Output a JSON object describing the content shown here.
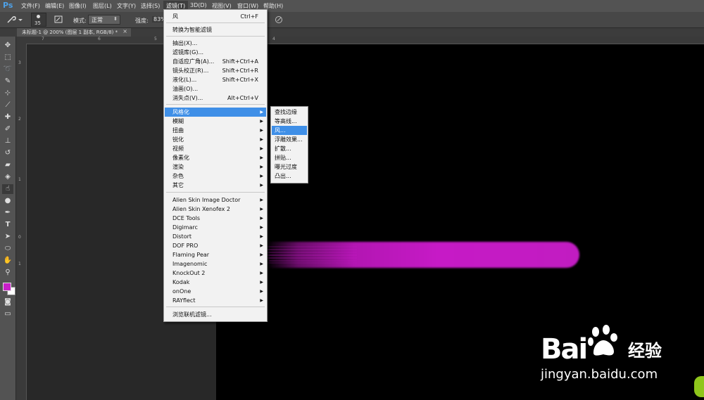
{
  "app": {
    "logo": "Ps"
  },
  "menubar": {
    "items": [
      "文件(F)",
      "编辑(E)",
      "图像(I)",
      "图层(L)",
      "文字(Y)",
      "选择(S)",
      "滤镜(T)",
      "3D(D)",
      "视图(V)",
      "窗口(W)",
      "帮助(H)"
    ],
    "active_index": 6
  },
  "options_bar": {
    "brush_size": "35",
    "mode_label": "模式:",
    "mode_value": "正常",
    "strength_label": "强度:",
    "strength_value": "83%"
  },
  "document_tab": {
    "title": "未标题-1 @ 200% (图层 1 副本, RGB/8) *",
    "close": "×"
  },
  "ruler": {
    "top_ticks": [
      "7",
      "6",
      "5",
      "4"
    ],
    "left_ticks": [
      "3",
      "2",
      "1",
      "0",
      "1"
    ]
  },
  "colors": {
    "foreground": "#c91fc9",
    "background": "#ffffff",
    "menu_highlight": "#3f8fe7",
    "streak": "#c61ac6"
  },
  "filter_menu": {
    "items": [
      {
        "label": "风",
        "shortcut": "Ctrl+F"
      },
      {
        "label": "转换为智能滤镜"
      },
      {
        "label": "抽出(X)..."
      },
      {
        "label": "滤镜库(G)..."
      },
      {
        "label": "自适应广角(A)...",
        "shortcut": "Shift+Ctrl+A"
      },
      {
        "label": "镜头校正(R)...",
        "shortcut": "Shift+Ctrl+R"
      },
      {
        "label": "液化(L)...",
        "shortcut": "Shift+Ctrl+X"
      },
      {
        "label": "油画(O)..."
      },
      {
        "label": "消失点(V)...",
        "shortcut": "Alt+Ctrl+V"
      },
      {
        "label": "风格化",
        "submenu": true
      },
      {
        "label": "模糊",
        "submenu": true
      },
      {
        "label": "扭曲",
        "submenu": true
      },
      {
        "label": "锐化",
        "submenu": true
      },
      {
        "label": "视频",
        "submenu": true
      },
      {
        "label": "像素化",
        "submenu": true
      },
      {
        "label": "渲染",
        "submenu": true
      },
      {
        "label": "杂色",
        "submenu": true
      },
      {
        "label": "其它",
        "submenu": true
      },
      {
        "label": "Alien Skin Image Doctor",
        "submenu": true
      },
      {
        "label": "Alien Skin Xenofex 2",
        "submenu": true
      },
      {
        "label": "DCE Tools",
        "submenu": true
      },
      {
        "label": "Digimarc",
        "submenu": true
      },
      {
        "label": "Distort",
        "submenu": true
      },
      {
        "label": "DOF PRO",
        "submenu": true
      },
      {
        "label": "Flaming Pear",
        "submenu": true
      },
      {
        "label": "Imagenomic",
        "submenu": true
      },
      {
        "label": "KnockOut 2",
        "submenu": true
      },
      {
        "label": "Kodak",
        "submenu": true
      },
      {
        "label": "onOne",
        "submenu": true
      },
      {
        "label": "RAYflect",
        "submenu": true
      },
      {
        "label": "浏览联机滤镜..."
      }
    ],
    "highlighted_index": 9
  },
  "stylize_submenu": {
    "items": [
      "查找边缘",
      "等高线...",
      "风...",
      "浮雕效果...",
      "扩散...",
      "拼贴...",
      "曝光过度",
      "凸出..."
    ],
    "highlighted_index": 2
  },
  "watermark": {
    "logo": "Bai",
    "logo_suffix": "经验",
    "url": "jingyan.baidu.com"
  }
}
